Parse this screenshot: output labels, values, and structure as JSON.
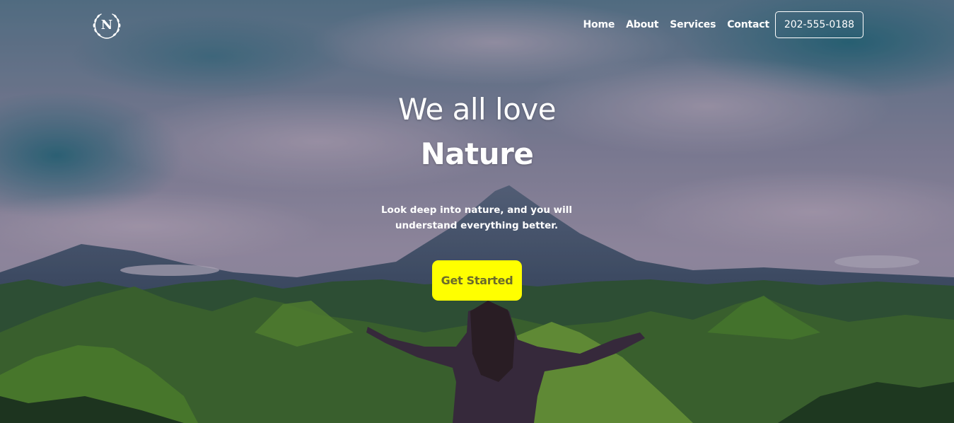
{
  "logo": {
    "letter": "N",
    "icon": "laurel-wreath-icon"
  },
  "nav": {
    "links": [
      "Home",
      "About",
      "Services",
      "Contact"
    ],
    "phone": "202-555-0188"
  },
  "hero": {
    "headline_line1": "We all love",
    "headline_line2": "Nature",
    "subtitle": "Look deep into nature, and you will understand everything better.",
    "cta_label": "Get Started"
  },
  "colors": {
    "cta_background": "#ffff00",
    "cta_text": "#6b6b2a",
    "text": "#ffffff"
  }
}
